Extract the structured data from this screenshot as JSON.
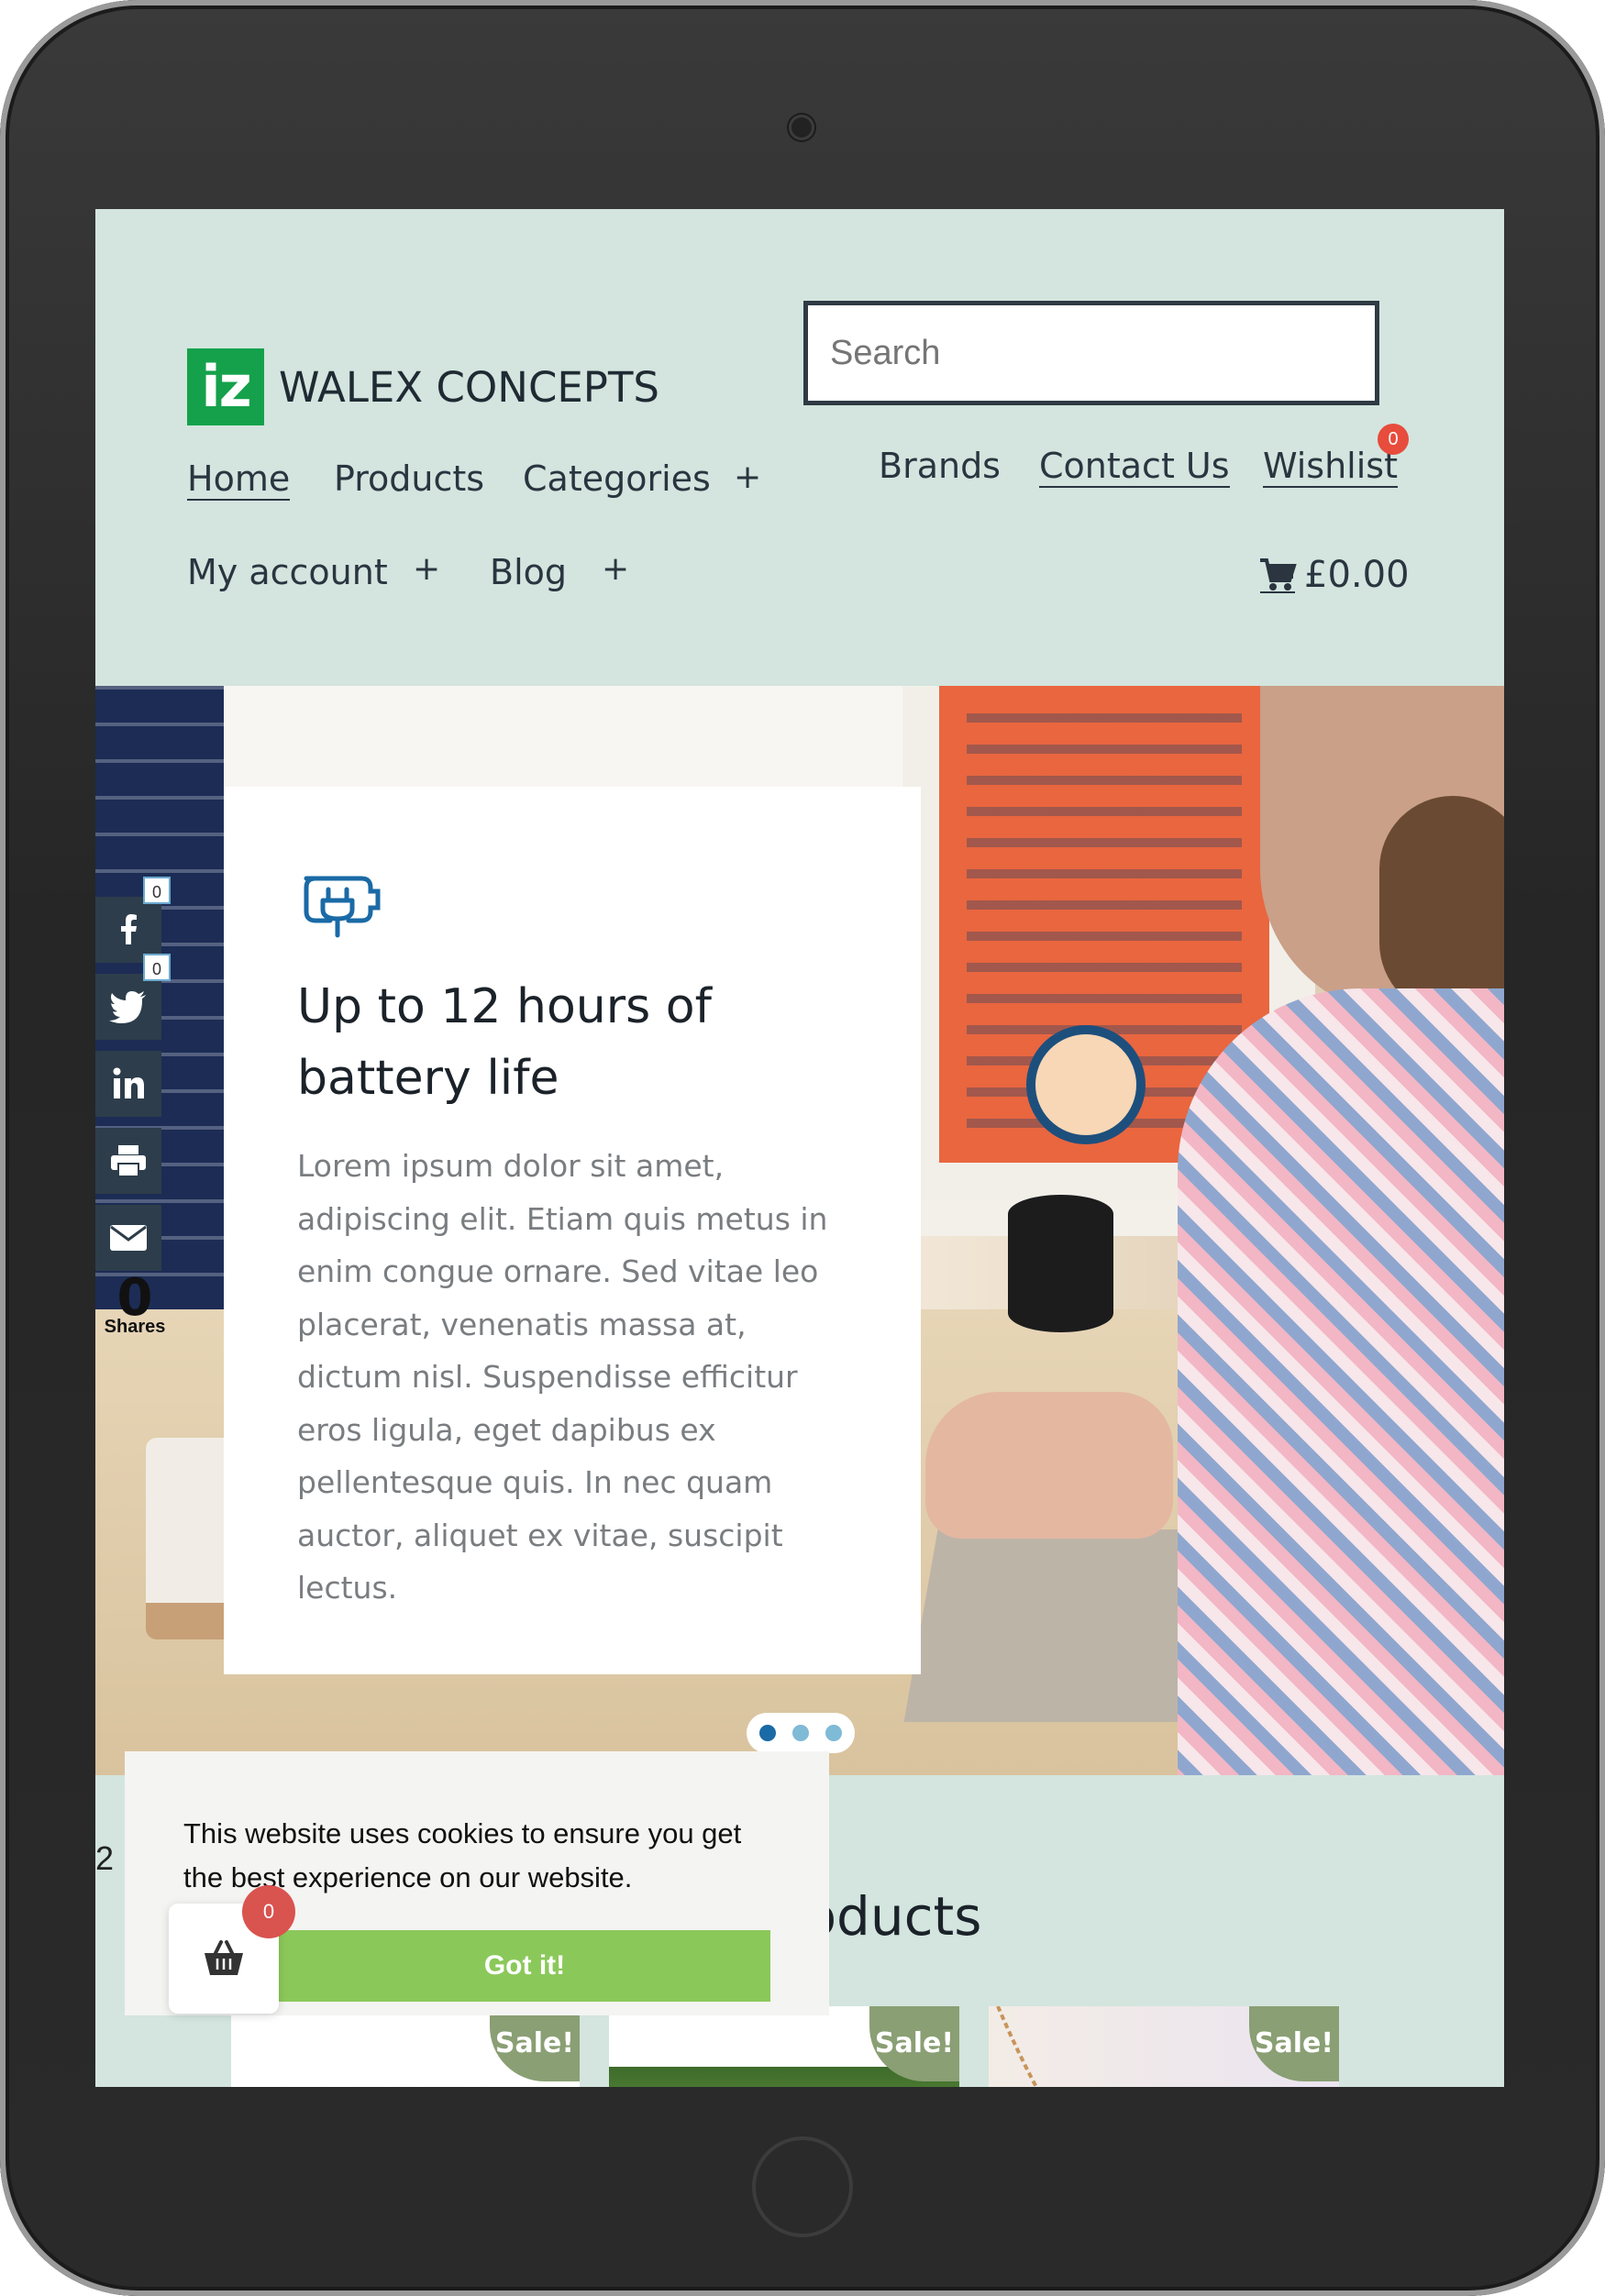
{
  "header": {
    "logo_mark": "iz",
    "logo_text": "WALEX CONCEPTS",
    "search_placeholder": "Search",
    "nav": {
      "home": "Home",
      "products": "Products",
      "categories": "Categories",
      "brands": "Brands",
      "contact": "Contact Us",
      "wishlist": "Wishlist",
      "my_account": "My account",
      "blog": "Blog",
      "expand": "+"
    },
    "wishlist_count": "0",
    "cart_total": "£0.00"
  },
  "hero": {
    "title": "Up to 12 hours of battery life",
    "body": "Lorem ipsum dolor sit amet, adipiscing elit. Etiam quis metus in enim congue ornare. Sed vitae leo placerat, venenatis massa at, dictum nisl. Suspendisse efficitur eros ligula, eget dapibus ex pellentesque quis. In nec quam auctor, aliquet ex vitae, suscipit lectus.",
    "slides": 3,
    "active_slide": 1
  },
  "share": {
    "facebook_count": "0",
    "twitter_count": "0",
    "total": "0",
    "total_label": "Shares",
    "icons": [
      "facebook-icon",
      "twitter-icon",
      "linkedin-icon",
      "print-icon",
      "email-icon"
    ]
  },
  "section": {
    "number": "2",
    "title_visible": "roducts"
  },
  "products": {
    "sale_label": "Sale!"
  },
  "cookie": {
    "text": "This website uses cookies to ensure you get the best experience on our website.",
    "button": "Got it!"
  },
  "floating_cart": {
    "count": "0"
  },
  "colors": {
    "page_bg": "#d3e5de",
    "logo_green": "#15a14b",
    "accept_green": "#8bc85a",
    "sale_badge": "#8a9f74",
    "badge_red": "#e74c3c",
    "share_bg": "#2d3d4b",
    "slider_active": "#1a6aa6"
  }
}
